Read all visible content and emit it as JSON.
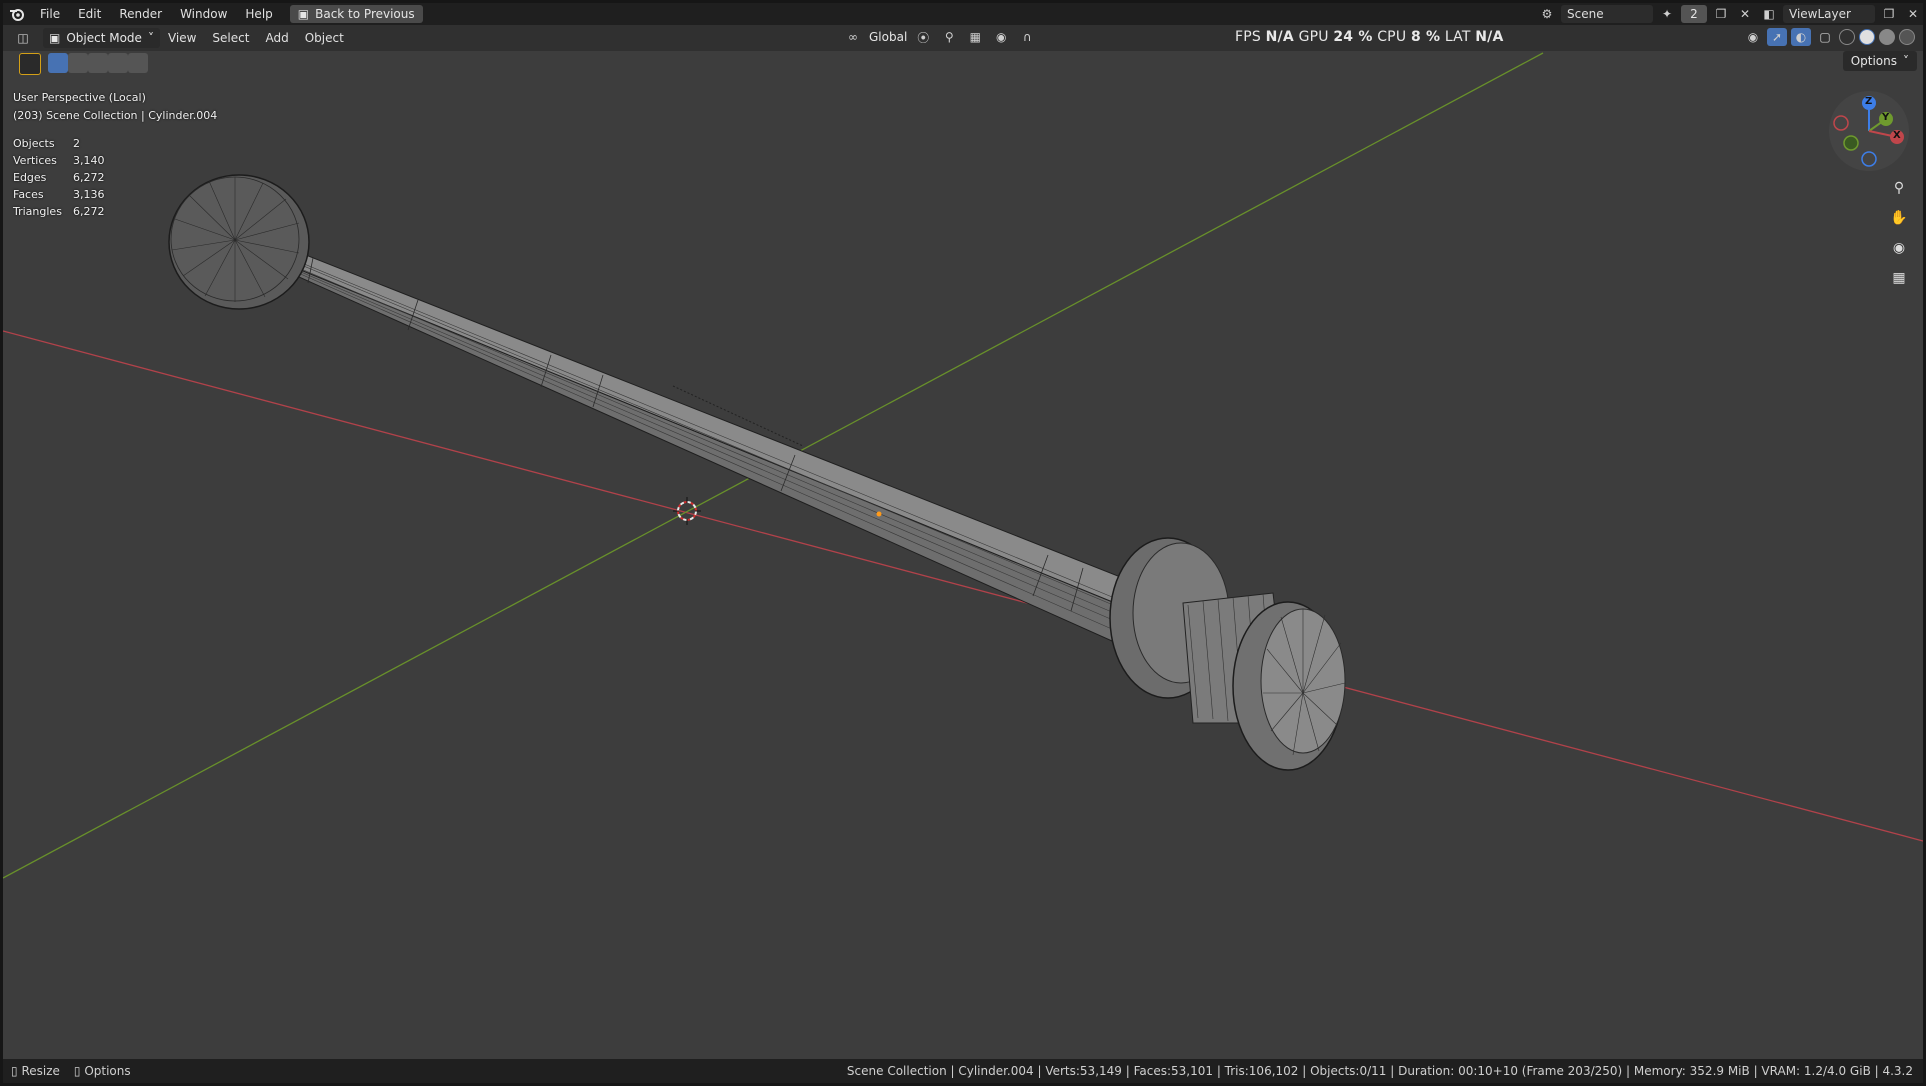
{
  "menubar": {
    "items": [
      "File",
      "Edit",
      "Render",
      "Window",
      "Help"
    ],
    "back_button": "Back to Previous",
    "scene_name": "Scene",
    "scene_count": "2",
    "view_layer": "ViewLayer"
  },
  "viewport_header": {
    "mode": "Object Mode",
    "menus": [
      "View",
      "Select",
      "Add",
      "Object"
    ],
    "orientation": "Global",
    "options": "Options"
  },
  "perf": {
    "fps_label": "FPS",
    "fps_value": "N/A",
    "gpu_label": "GPU",
    "gpu_value": "24 %",
    "cpu_label": "CPU",
    "cpu_value": "8 %",
    "lat_label": "LAT",
    "lat_value": "N/A"
  },
  "overlay_info": {
    "view_name": "User Perspective (Local)",
    "collection": "(203) Scene Collection | Cylinder.004"
  },
  "stats": [
    {
      "label": "Objects",
      "value": "2"
    },
    {
      "label": "Vertices",
      "value": "3,140"
    },
    {
      "label": "Edges",
      "value": "6,272"
    },
    {
      "label": "Faces",
      "value": "3,136"
    },
    {
      "label": "Triangles",
      "value": "6,272"
    }
  ],
  "gizmo": {
    "z": "Z",
    "y": "Y",
    "x": "X"
  },
  "statusbar": {
    "resize": "Resize",
    "options": "Options",
    "info": "Scene Collection | Cylinder.004 | Verts:53,149 | Faces:53,101 | Tris:106,102 | Objects:0/11 | Duration: 00:10+10 (Frame 203/250) | Memory: 352.9 MiB | VRAM: 1.2/4.0 GiB | 4.3.2"
  },
  "colors": {
    "viewport_bg": "#3d3d3d",
    "x_axis": "#c0464b",
    "y_axis": "#6f9a2e",
    "z_axis": "#3d7ee8",
    "active_blue": "#4772b3"
  }
}
